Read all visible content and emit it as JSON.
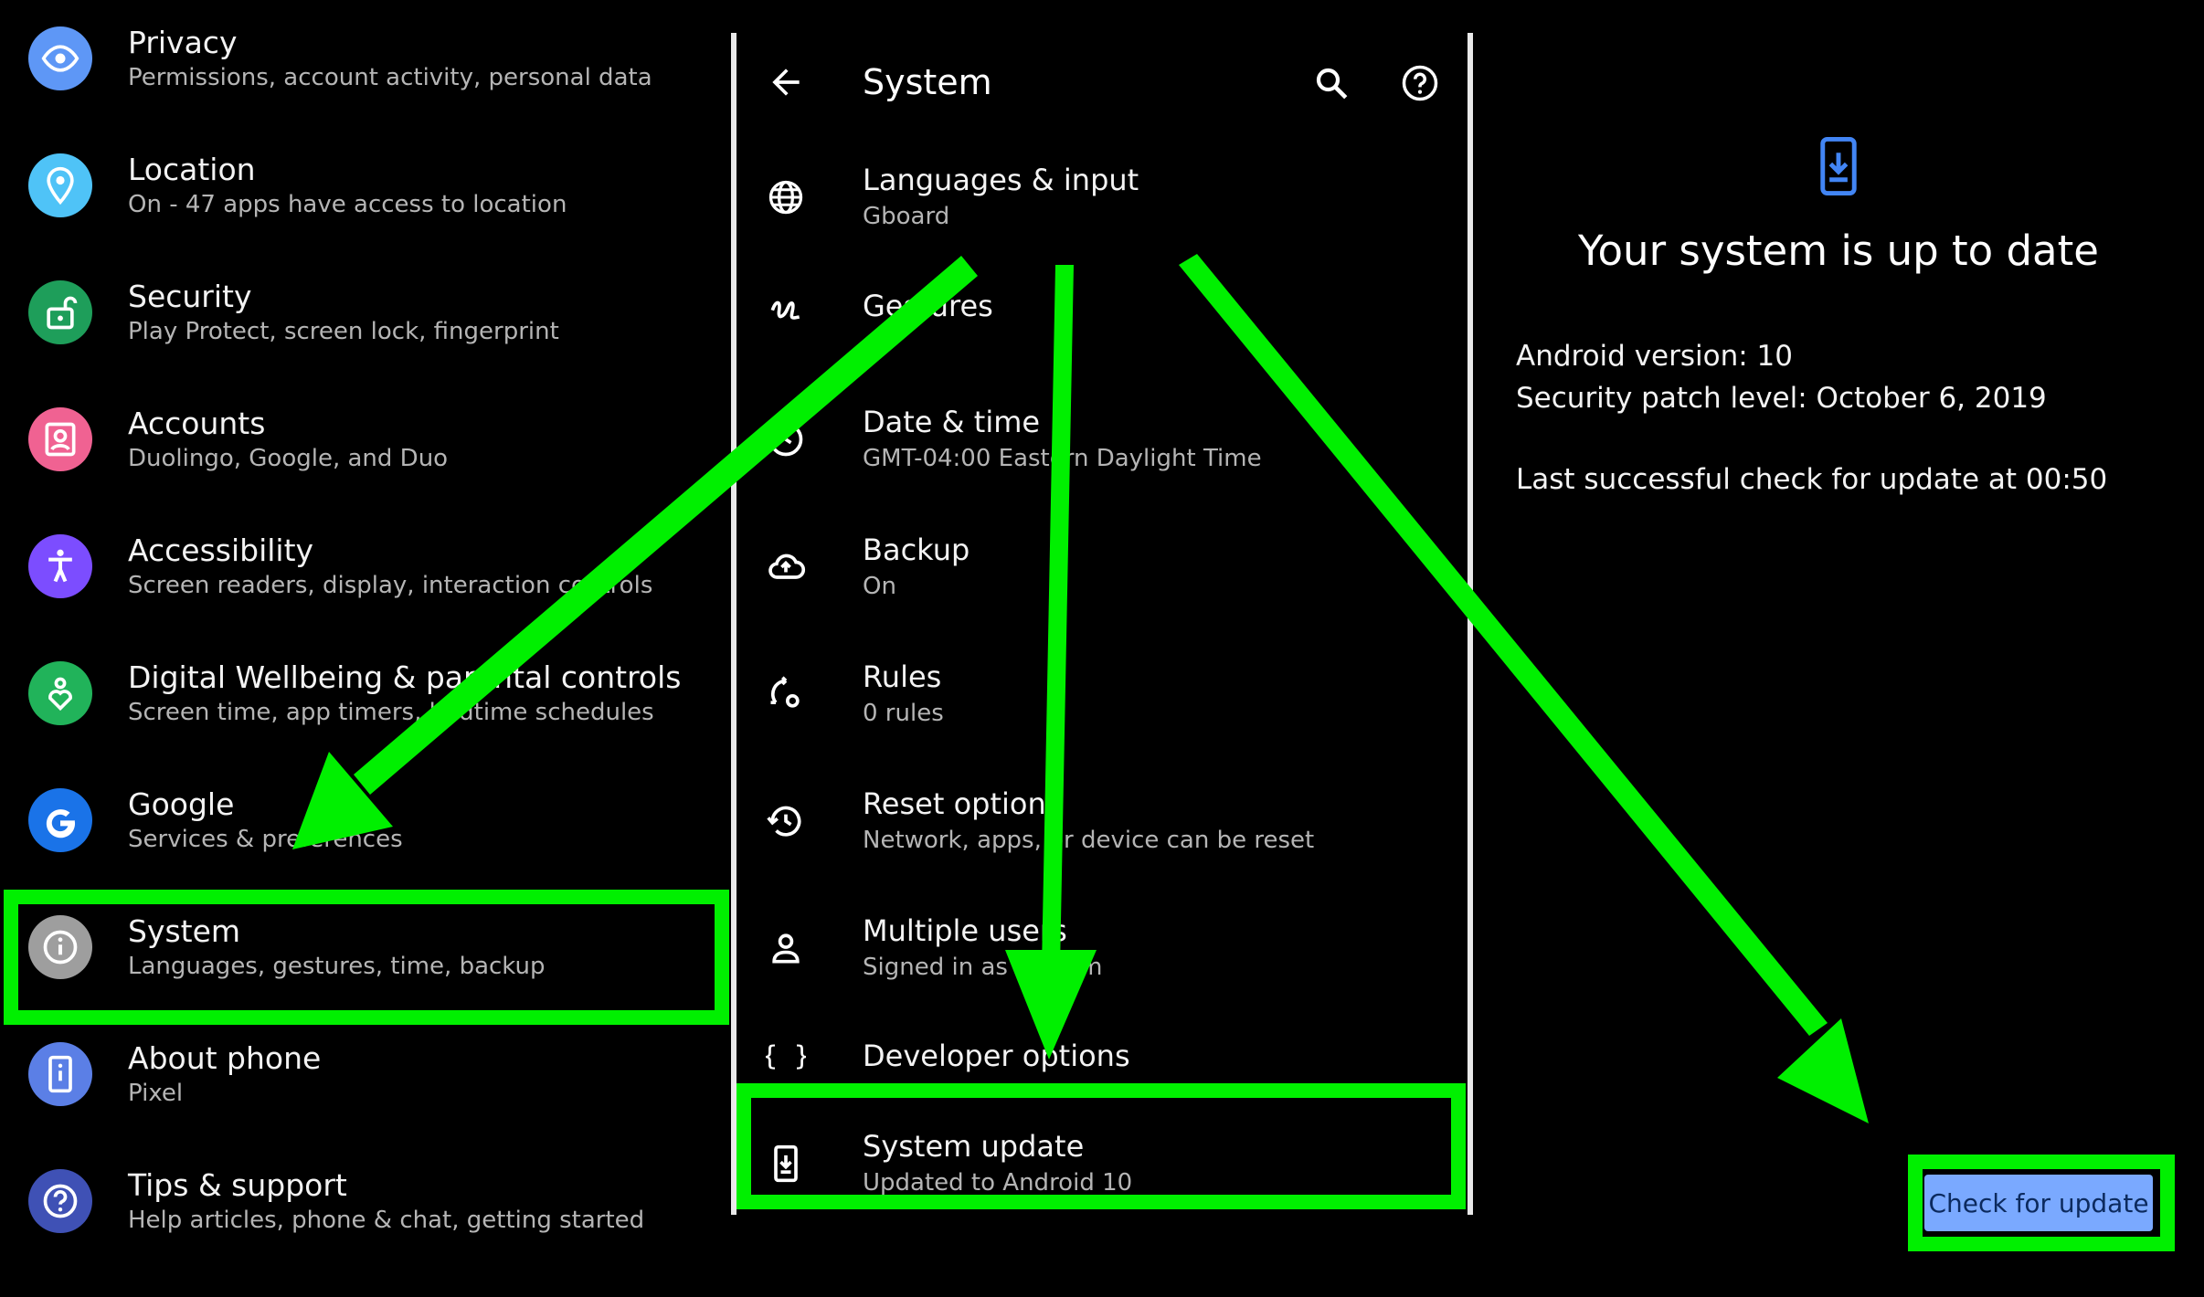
{
  "left": {
    "items": [
      {
        "title": "Privacy",
        "subtitle": "Permissions, account activity, personal data",
        "icon": "privacy-eye-icon",
        "color": "#5e97f6"
      },
      {
        "title": "Location",
        "subtitle": "On - 47 apps have access to location",
        "icon": "location-pin-icon",
        "color": "#4fc3f7"
      },
      {
        "title": "Security",
        "subtitle": "Play Protect, screen lock, fingerprint",
        "icon": "lock-open-icon",
        "color": "#1e9e5a"
      },
      {
        "title": "Accounts",
        "subtitle": "Duolingo, Google, and Duo",
        "icon": "account-box-icon",
        "color": "#f06292"
      },
      {
        "title": "Accessibility",
        "subtitle": "Screen readers, display, interaction controls",
        "icon": "accessibility-icon",
        "color": "#7c4dff"
      },
      {
        "title": "Digital Wellbeing & parental controls",
        "subtitle": "Screen time, app timers, bedtime schedules",
        "icon": "wellbeing-heart-icon",
        "color": "#21b35a"
      },
      {
        "title": "Google",
        "subtitle": "Services & preferences",
        "icon": "google-g-icon",
        "color": "#1a73e8"
      },
      {
        "title": "System",
        "subtitle": "Languages, gestures, time, backup",
        "icon": "info-icon",
        "color": "#9e9e9e"
      },
      {
        "title": "About phone",
        "subtitle": "Pixel",
        "icon": "phone-info-icon",
        "color": "#5b7fe6"
      },
      {
        "title": "Tips & support",
        "subtitle": "Help articles, phone & chat, getting started",
        "icon": "help-icon",
        "color": "#3f51b5"
      }
    ]
  },
  "middle": {
    "title": "System",
    "items": [
      {
        "title": "Languages & input",
        "subtitle": "Gboard",
        "icon": "globe-icon"
      },
      {
        "title": "Gestures",
        "subtitle": "",
        "icon": "gesture-icon"
      },
      {
        "title": "Date & time",
        "subtitle": "GMT-04:00 Eastern Daylight Time",
        "icon": "clock-icon"
      },
      {
        "title": "Backup",
        "subtitle": "On",
        "icon": "cloud-upload-icon"
      },
      {
        "title": "Rules",
        "subtitle": "0 rules",
        "icon": "rules-sync-icon"
      },
      {
        "title": "Reset options",
        "subtitle": "Network, apps, or device can be reset",
        "icon": "history-icon"
      },
      {
        "title": "Multiple users",
        "subtitle": "Signed in as William",
        "icon": "person-icon"
      },
      {
        "title": "Developer options",
        "subtitle": "",
        "icon": "braces-icon"
      },
      {
        "title": "System update",
        "subtitle": "Updated to Android 10",
        "icon": "system-update-icon"
      }
    ]
  },
  "right": {
    "heading": "Your system is up to date",
    "android_version": "Android version: 10",
    "security_patch": "Security patch level: October 6, 2019",
    "last_check": "Last successful check for update at 00:50",
    "button_label": "Check for update"
  },
  "colors": {
    "highlight": "#00f000",
    "button": "#7aa9ff",
    "accent": "#4285f4"
  }
}
